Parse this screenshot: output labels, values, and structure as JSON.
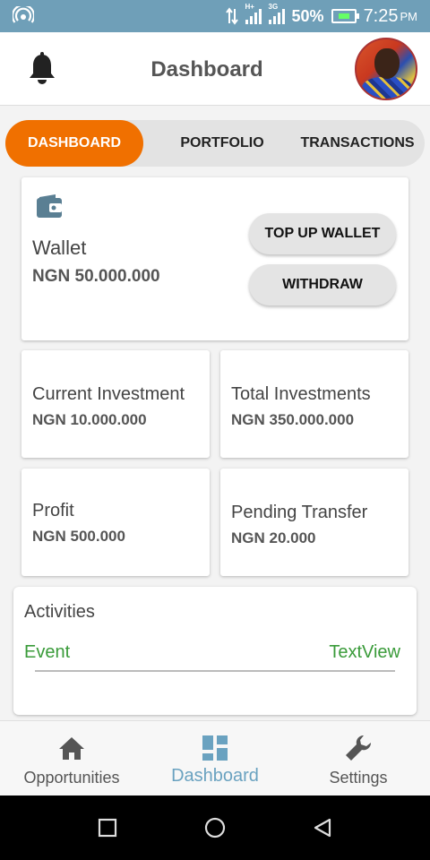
{
  "status_bar": {
    "network_type_1": "H+",
    "network_type_2": "3G",
    "battery_percent": "50%",
    "time": "7:25",
    "ampm": "PM"
  },
  "app_bar": {
    "title": "Dashboard"
  },
  "tabs": [
    {
      "label": "DASHBOARD",
      "active": true
    },
    {
      "label": "PORTFOLIO",
      "active": false
    },
    {
      "label": "TRANSACTIONS",
      "active": false
    }
  ],
  "wallet": {
    "title": "Wallet",
    "amount": "NGN 50.000.000",
    "top_up_label": "TOP UP WALLET",
    "withdraw_label": "WITHDRAW"
  },
  "stats": [
    {
      "label": "Current Investment",
      "value": "NGN 10.000.000"
    },
    {
      "label": "Total Investments",
      "value": "NGN 350.000.000"
    },
    {
      "label": "Profit",
      "value": "NGN 500.000"
    },
    {
      "label": "Pending Transfer",
      "value": "NGN 20.000"
    }
  ],
  "activities": {
    "title": "Activities",
    "event_label": "Event",
    "textview_label": "TextView"
  },
  "bottom_nav": [
    {
      "label": "Opportunities",
      "icon": "home-icon"
    },
    {
      "label": "Dashboard",
      "icon": "dashboard-icon",
      "active": true
    },
    {
      "label": "Settings",
      "icon": "wrench-icon"
    }
  ],
  "colors": {
    "accent": "#f07000",
    "status_bar": "#6f9fb8",
    "active_nav": "#6aa2c0",
    "event_green": "#3a9b3a"
  }
}
